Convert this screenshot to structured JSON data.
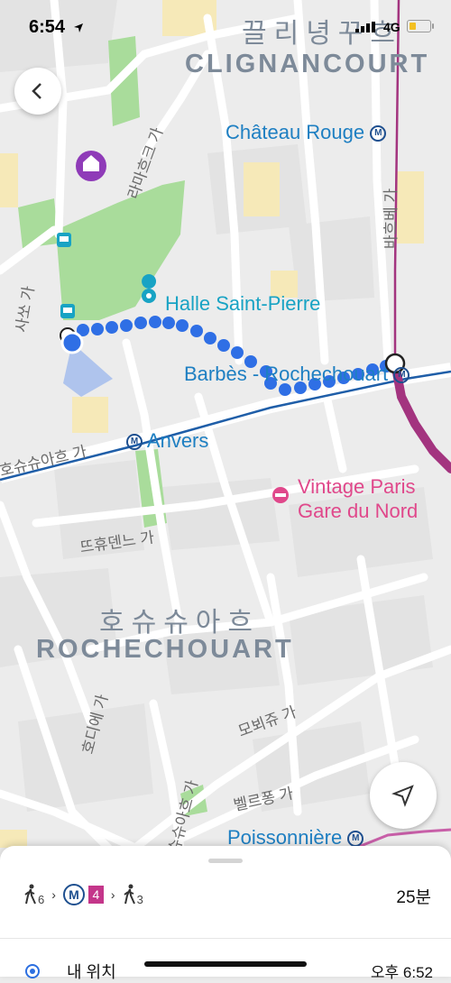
{
  "status_bar": {
    "time": "6:54",
    "network": "4G"
  },
  "map": {
    "districts": [
      {
        "ko": "끌리녕꾸흐",
        "en": "CLIGNANCOURT"
      },
      {
        "ko": "호슈슈아흐",
        "en": "ROCHECHOUART"
      }
    ],
    "stations": {
      "chateau_rouge": "Château Rouge",
      "barbes": "Barbès - Rochechouart",
      "anvers": "Anvers",
      "poissonniere": "Poissonnière"
    },
    "metro_symbol": "M",
    "pois": {
      "halle": "Halle Saint-Pierre",
      "hotel_line1": "Vintage Paris",
      "hotel_line2": "Gare du Nord"
    },
    "streets": {
      "barbes_blvd": "바흐베 가",
      "lamarck": "라마흐크 가",
      "sanso": "사쏘 가",
      "rochechouart_blvd": "호슈슈아흐 가",
      "trudaine": "뜨휴덴느 가",
      "maubeuge": "모뵈쥬 가",
      "bellefond": "벨르퐁 가",
      "rodier": "호디에 가",
      "rochechouart_st": "호슈슈아흐 가"
    },
    "colors": {
      "route_dot": "#2f6fe5",
      "metro_line_4": "#a3347f",
      "metro_line_2": "#1f5ea8",
      "park": "#a9dc9b"
    }
  },
  "buttons": {
    "back_icon": "chevron-left",
    "locate_icon": "navigation-arrow"
  },
  "sheet": {
    "walk_start_minutes": "6",
    "metro_symbol": "M",
    "metro_line": "4",
    "walk_end_minutes": "3",
    "duration": "25분",
    "origin_label": "내 위치",
    "departure_time": "오후 6:52"
  }
}
